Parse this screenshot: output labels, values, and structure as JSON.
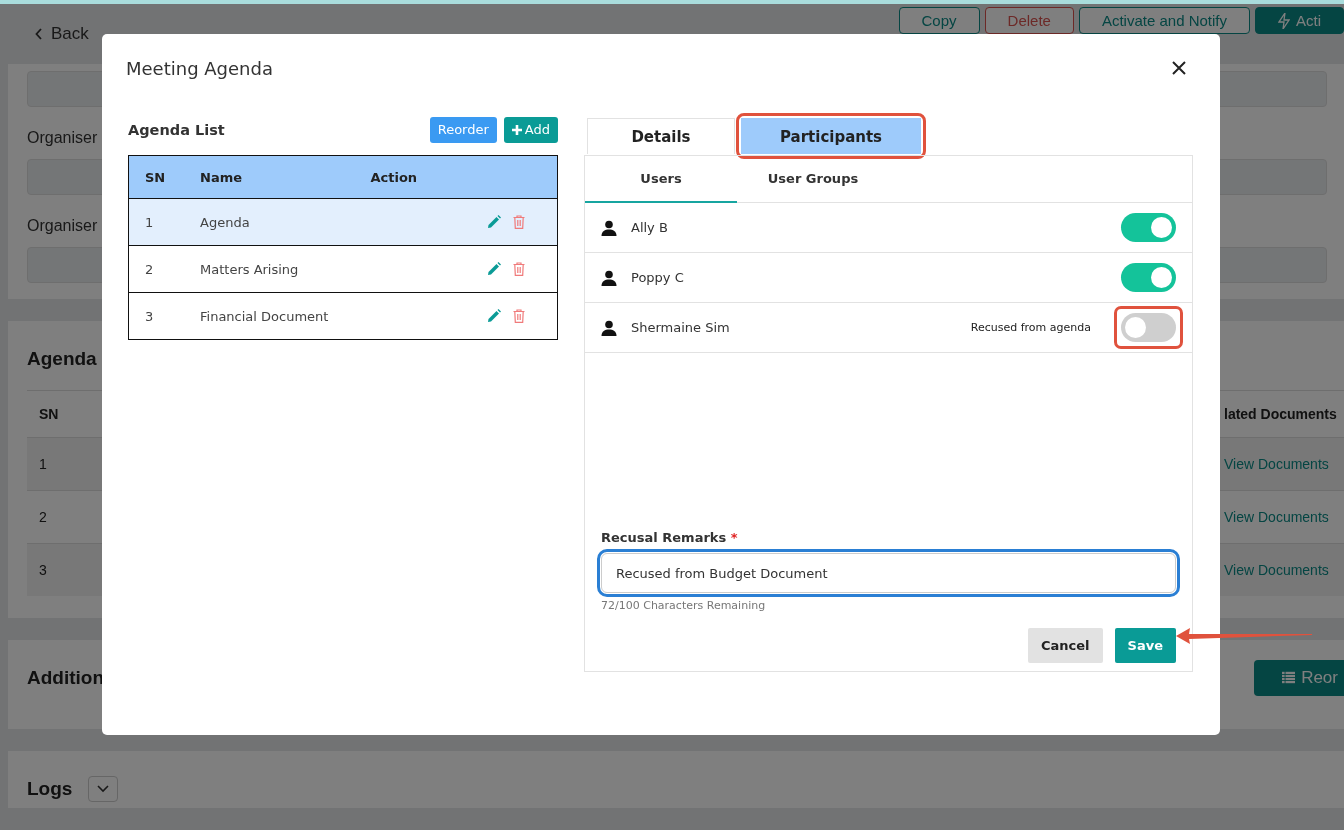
{
  "page": {
    "back": "Back",
    "actions": [
      {
        "label": "Copy",
        "kind": "outline"
      },
      {
        "label": "Delete",
        "kind": "danger"
      },
      {
        "label": "Activate and Notify",
        "kind": "outline"
      },
      {
        "label": "Acti",
        "kind": "solid"
      }
    ],
    "organiser_labels": [
      "Organiser",
      "Organiser"
    ],
    "agenda_section": {
      "title": "Agenda",
      "columns": [
        "SN",
        "lated Documents"
      ],
      "rows": [
        {
          "sn": "1",
          "link": "View Documents"
        },
        {
          "sn": "2",
          "link": "View Documents"
        },
        {
          "sn": "3",
          "link": "View Documents"
        }
      ]
    },
    "additional_section": {
      "title": "Addition",
      "button": "Reor"
    },
    "logs_section": {
      "title": "Logs"
    }
  },
  "modal": {
    "title": "Meeting Agenda",
    "agenda_list": {
      "title": "Agenda List",
      "reorder": "Reorder",
      "add": "Add",
      "columns": [
        "SN",
        "Name",
        "Action"
      ],
      "rows": [
        {
          "sn": "1",
          "name": "Agenda",
          "selected": true
        },
        {
          "sn": "2",
          "name": "Matters Arising",
          "selected": false
        },
        {
          "sn": "3",
          "name": "Financial Document",
          "selected": false
        }
      ]
    },
    "tabs": [
      {
        "label": "Details",
        "selected": false,
        "highlighted": false
      },
      {
        "label": "Participants",
        "selected": true,
        "highlighted": true
      }
    ],
    "subtabs": [
      {
        "label": "Users",
        "selected": true
      },
      {
        "label": "User Groups",
        "selected": false
      }
    ],
    "participants": [
      {
        "name": "Ally B",
        "on": true,
        "highlighted": false
      },
      {
        "name": "Poppy C",
        "on": true,
        "highlighted": false
      },
      {
        "name": "Shermaine Sim",
        "on": false,
        "note": "Recused from agenda",
        "highlighted": true
      }
    ],
    "remarks": {
      "label": "Recusal Remarks",
      "required_mark": "*",
      "value": "Recused from Budget Document",
      "counter": "72/100 Characters Remaining",
      "focused": true
    },
    "buttons": {
      "cancel": "Cancel",
      "save": "Save"
    }
  }
}
